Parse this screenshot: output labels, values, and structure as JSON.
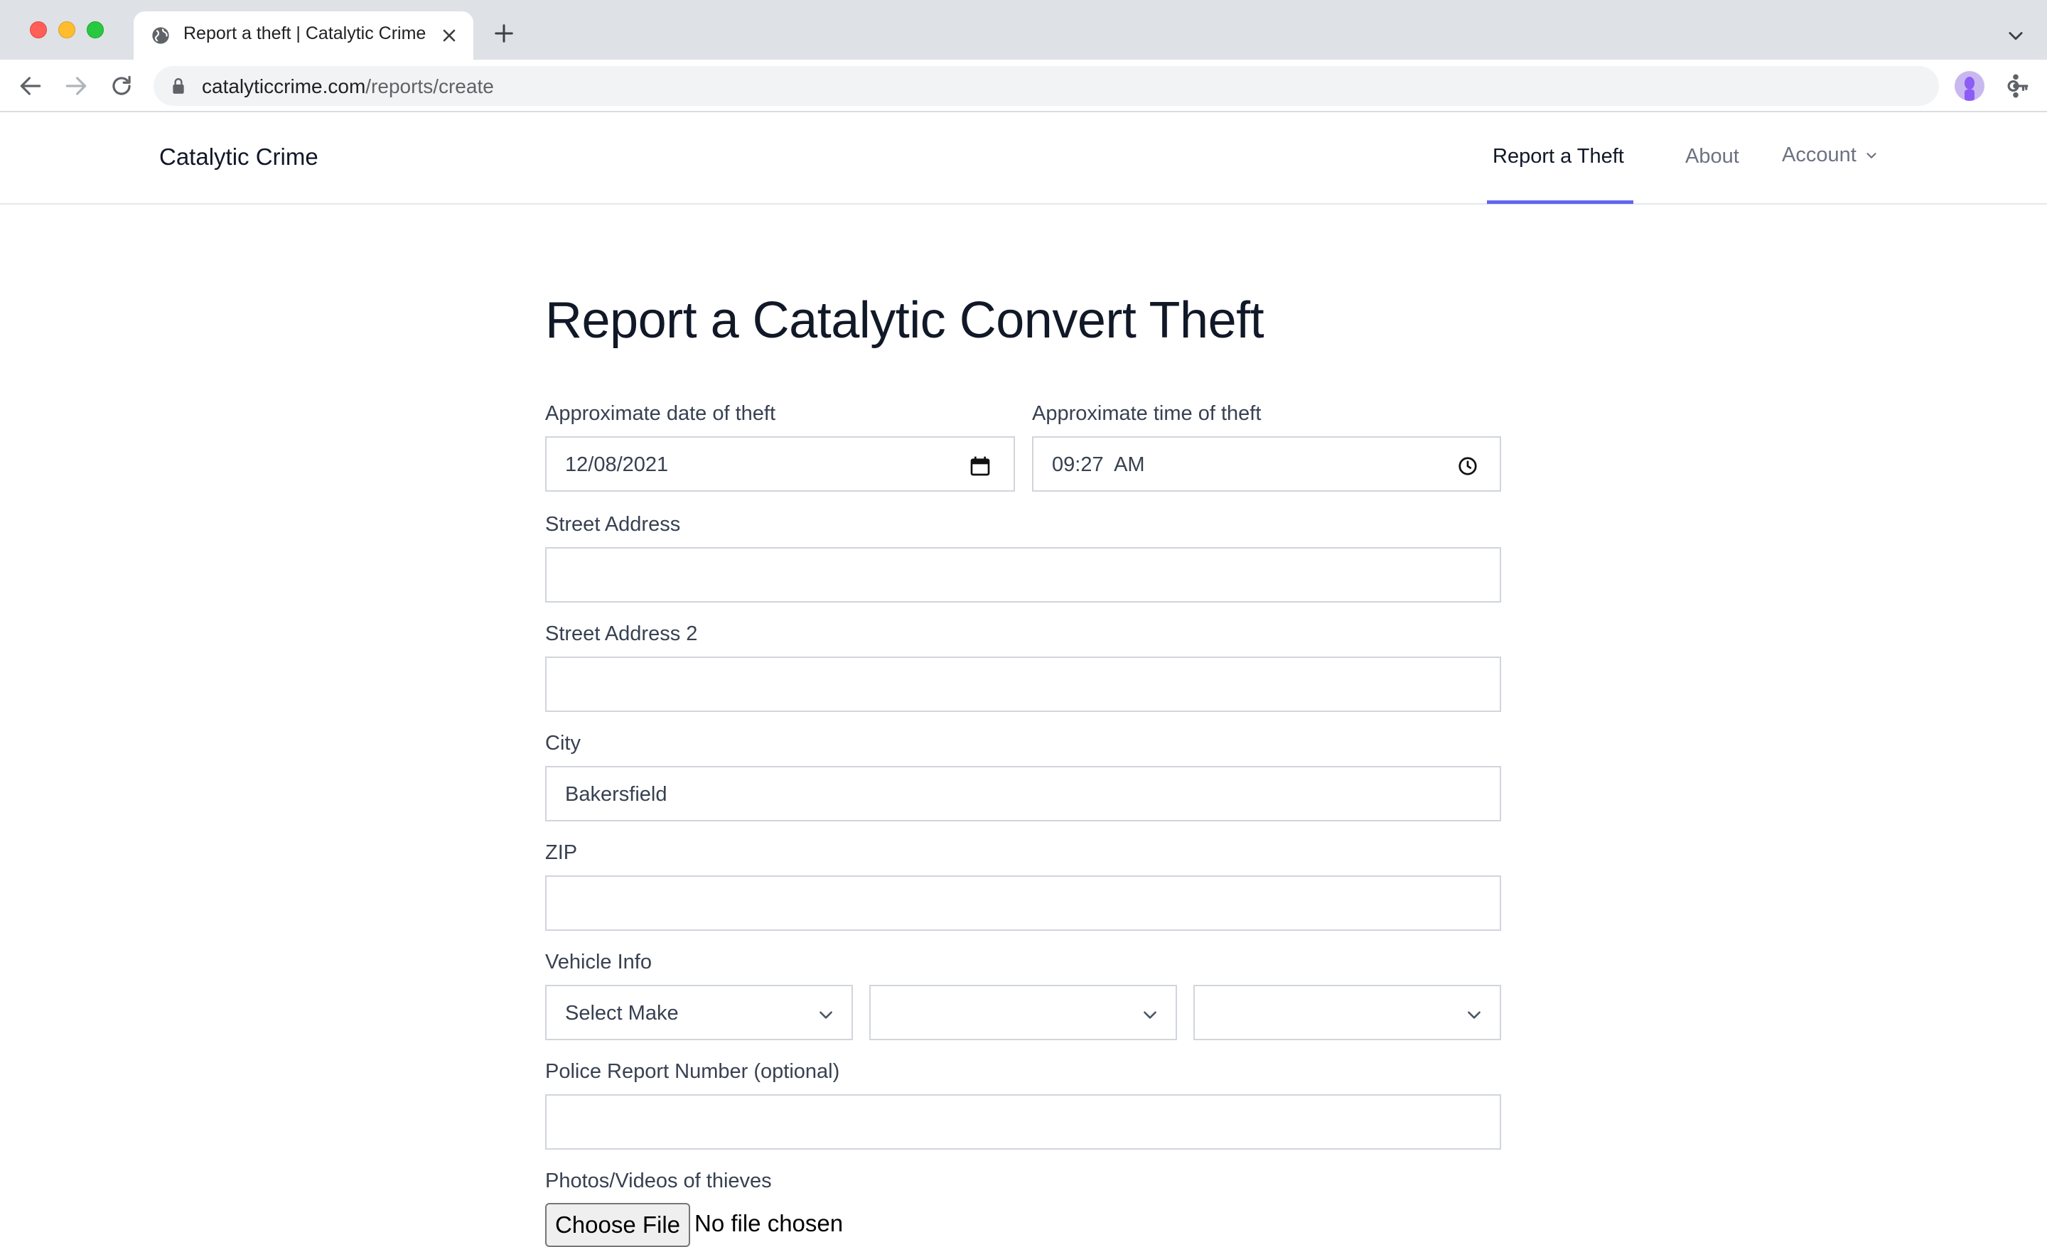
{
  "browser": {
    "tab_title": "Report a theft | Catalytic Crime",
    "url_host": "catalyticcrime.com",
    "url_path": "/reports/create"
  },
  "site": {
    "brand": "Catalytic Crime",
    "nav": {
      "report": "Report a Theft",
      "about": "About",
      "account": "Account"
    },
    "active_nav": "Report a Theft",
    "accent_color": "#6366f1"
  },
  "form": {
    "title": "Report a Catalytic Convert Theft",
    "date": {
      "label": "Approximate date of theft",
      "value": "12/08/2021"
    },
    "time": {
      "label": "Approximate time of theft",
      "value": "09:27  AM"
    },
    "street": {
      "label": "Street Address",
      "value": ""
    },
    "street2": {
      "label": "Street Address 2",
      "value": ""
    },
    "city": {
      "label": "City",
      "value": "Bakersfield"
    },
    "zip": {
      "label": "ZIP",
      "value": ""
    },
    "vehicle": {
      "label": "Vehicle Info",
      "make": "Select Make",
      "model": "",
      "year": ""
    },
    "police": {
      "label": "Police Report Number (optional)",
      "value": ""
    },
    "media": {
      "label": "Photos/Videos of thieves",
      "button": "Choose File",
      "status": "No file chosen"
    }
  },
  "icons": {
    "tab": "globe-icon",
    "date": "calendar-icon",
    "time": "clock-icon",
    "select": "chevron-down-icon"
  }
}
